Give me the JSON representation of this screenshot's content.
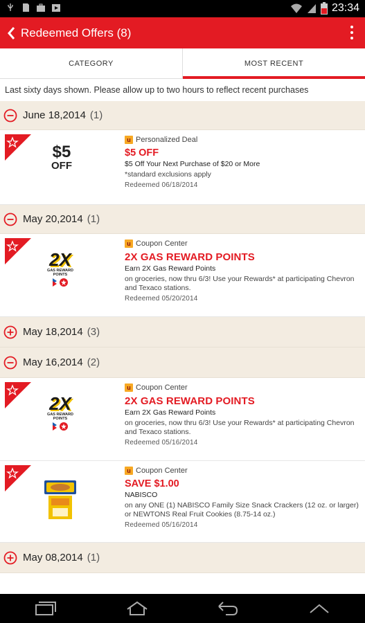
{
  "status_bar": {
    "time": "23:34",
    "left_icons": [
      "usb-icon",
      "sd-card-icon",
      "briefcase-icon",
      "play-store-icon"
    ],
    "right_icons": [
      "wifi-icon",
      "signal-icon",
      "battery-icon"
    ]
  },
  "app_bar": {
    "title": "Redeemed Offers (8)",
    "back_icon": "chevron-left-icon",
    "menu_icon": "overflow-menu-icon",
    "accent_color": "#e31b23"
  },
  "tabs": [
    {
      "label": "CATEGORY",
      "active": false
    },
    {
      "label": "MOST RECENT",
      "active": true
    }
  ],
  "notice": "Last sixty days shown. Please allow up to two hours to reflect recent purchases",
  "groups": [
    {
      "date": "June 18,2014",
      "count": "(1)",
      "expanded": true,
      "offers": [
        {
          "source": "Personalized Deal",
          "title": "$5 OFF",
          "subtitle": "$5 Off Your Next Purchase of $20 or More",
          "description": "*standard exclusions apply",
          "redeemed": "Redeemed 06/18/2014",
          "image_text_top": "$5",
          "image_text_bottom": "OFF"
        }
      ]
    },
    {
      "date": "May 20,2014",
      "count": "(1)",
      "expanded": true,
      "offers": [
        {
          "source": "Coupon Center",
          "title": "2X GAS REWARD POINTS",
          "subtitle": "Earn 2X Gas Reward Points",
          "description": "on groceries, now thru 6/3! Use your Rewards* at participating Chevron and Texaco stations.",
          "redeemed": "Redeemed 05/20/2014",
          "image_text_top": "2X",
          "image_text_bottom": "GAS REWARD POINTS"
        }
      ]
    },
    {
      "date": "May 18,2014",
      "count": "(3)",
      "expanded": false
    },
    {
      "date": "May 16,2014",
      "count": "(2)",
      "expanded": true,
      "offers": [
        {
          "source": "Coupon Center",
          "title": "2X GAS REWARD POINTS",
          "subtitle": "Earn 2X Gas Reward Points",
          "description": "on groceries, now thru 6/3! Use your Rewards* at participating Chevron and Texaco stations.",
          "redeemed": "Redeemed 05/16/2014",
          "image_text_top": "2X",
          "image_text_bottom": "GAS REWARD POINTS"
        },
        {
          "source": "Coupon Center",
          "title": "SAVE $1.00",
          "subtitle": "NABISCO",
          "description": "on any ONE (1) NABISCO Family Size Snack Crackers (12 oz. or larger) or NEWTONS Real Fruit Cookies (8.75-14 oz.)",
          "redeemed": "Redeemed 05/16/2014"
        }
      ]
    },
    {
      "date": "May 08,2014",
      "count": "(1)",
      "expanded": false
    }
  ],
  "nav_bar": {
    "icons": [
      "recent-apps-icon",
      "home-icon",
      "back-icon",
      "menu-up-icon"
    ]
  }
}
